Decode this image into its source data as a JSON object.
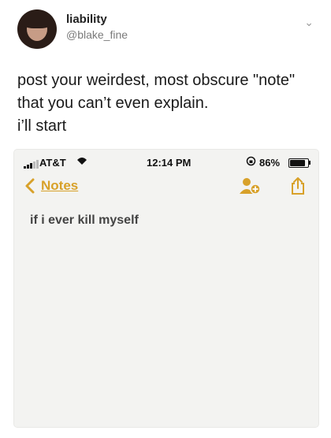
{
  "tweet": {
    "name": "liability",
    "handle": "@blake_fine",
    "text_lines": [
      "post your weirdest, most obscure \"note\"",
      "that you can’t even explain.",
      "i’ll start"
    ]
  },
  "phone": {
    "status": {
      "carrier": "AT&T",
      "time": "12:14 PM",
      "battery_percent": "86%",
      "battery_level": 0.86
    },
    "nav": {
      "back_label": "Notes"
    },
    "note": {
      "text": "if i ever kill myself"
    }
  },
  "icons": {
    "back": "chevron-left-icon",
    "collab": "add-people-icon",
    "share": "share-icon",
    "wifi": "wifi-icon",
    "rotate": "rotation-lock-icon"
  },
  "colors": {
    "accent": "#d8a12a"
  }
}
